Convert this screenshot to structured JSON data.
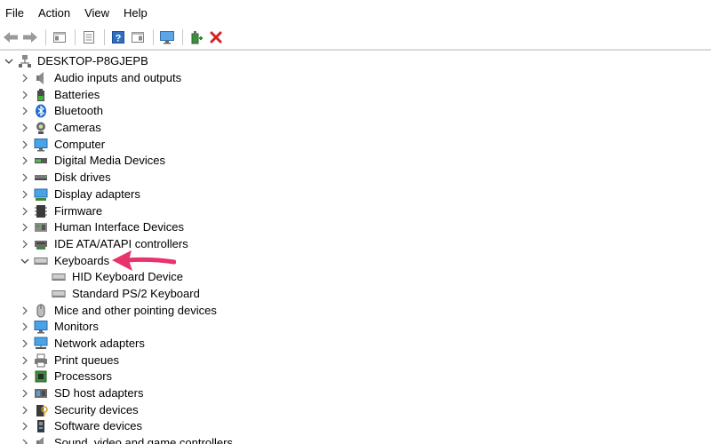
{
  "menu": {
    "file": "File",
    "action": "Action",
    "view": "View",
    "help": "Help"
  },
  "tree": {
    "root": "DESKTOP-P8GJEPB",
    "categories": {
      "audio": "Audio inputs and outputs",
      "batteries": "Batteries",
      "bluetooth": "Bluetooth",
      "cameras": "Cameras",
      "computer": "Computer",
      "digital_media": "Digital Media Devices",
      "disk": "Disk drives",
      "display": "Display adapters",
      "firmware": "Firmware",
      "hid": "Human Interface Devices",
      "ide": "IDE ATA/ATAPI controllers",
      "keyboards": "Keyboards",
      "mice": "Mice and other pointing devices",
      "monitors": "Monitors",
      "network": "Network adapters",
      "print": "Print queues",
      "processors": "Processors",
      "sd": "SD host adapters",
      "security": "Security devices",
      "software": "Software devices",
      "sound": "Sound, video and game controllers"
    },
    "keyboard_children": {
      "hid_keyboard": "HID Keyboard Device",
      "ps2_keyboard": "Standard PS/2 Keyboard"
    }
  },
  "colors": {
    "annotation_arrow": "#e8336d",
    "delete_icon": "#d42020",
    "accent": "#2a7bd6"
  }
}
